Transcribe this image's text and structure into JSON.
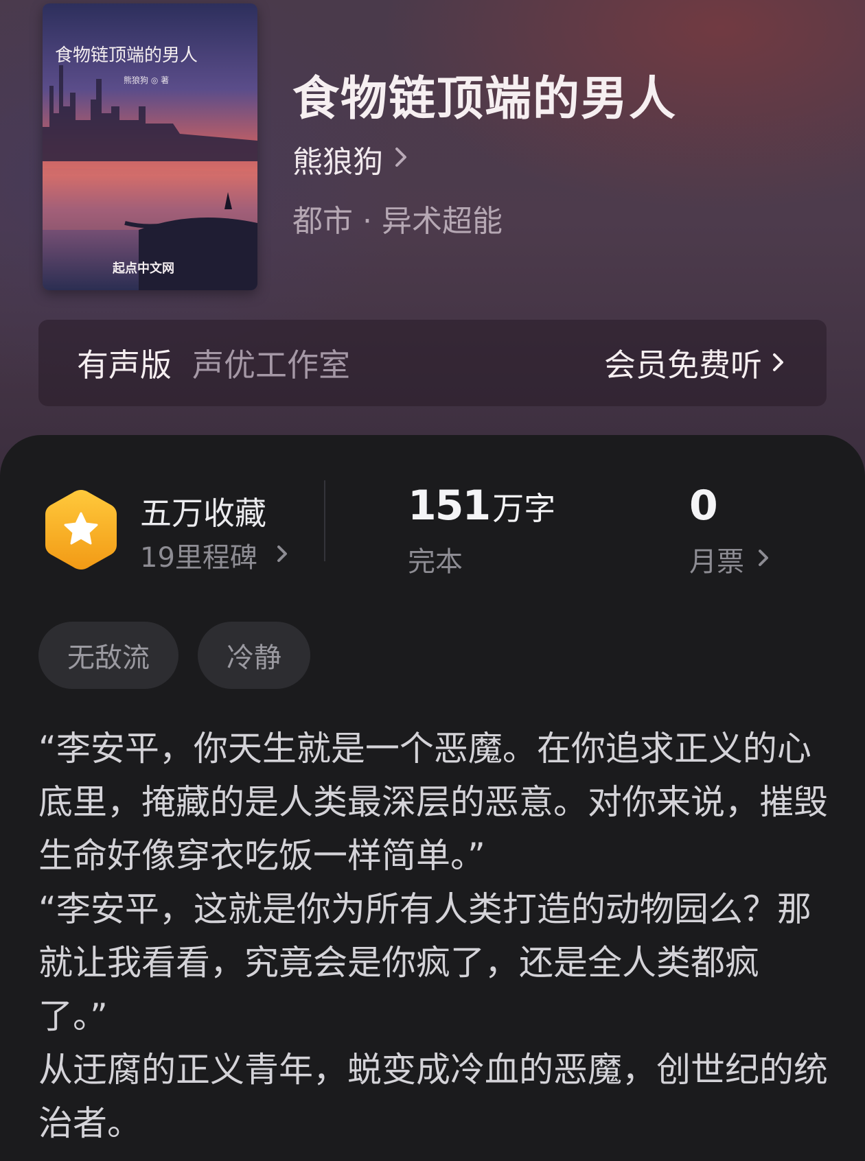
{
  "book": {
    "title": "食物链顶端的男人",
    "author": "熊狼狗",
    "genre": "都市 · 异术超能",
    "cover": {
      "title": "食物链顶端的男人",
      "author_line": "熊狼狗 ◎ 著",
      "publisher": "起点中文网"
    }
  },
  "audio": {
    "label": "有声版",
    "studio": "声优工作室",
    "cta": "会员免费听"
  },
  "stats": {
    "favorites_title": "五万收藏",
    "favorites_sub": "19里程碑",
    "word_count_number": "151",
    "word_count_unit": "万字",
    "status": "完本",
    "monthly_votes": "0",
    "monthly_votes_label": "月票"
  },
  "tags": [
    "无敌流",
    "冷静"
  ],
  "synopsis": [
    "“李安平，你天生就是一个恶魔。在你追求正义的心底里，掩藏的是人类最深层的恶意。对你来说，摧毁生命好像穿衣吃饭一样简单。”",
    "“李安平，这就是你为所有人类打造的动物园么？那就让我看看，究竟会是你疯了，还是全人类都疯了。”",
    "从迂腐的正义青年，蜕变成冷血的恶魔，创世纪的统治者。"
  ],
  "colors": {
    "hero_bg": "#4a3a4b",
    "panel_bg": "#1b1b1d",
    "badge_gold": "#f7b52a"
  },
  "icons": [
    "chevron-right-icon",
    "star-icon"
  ]
}
